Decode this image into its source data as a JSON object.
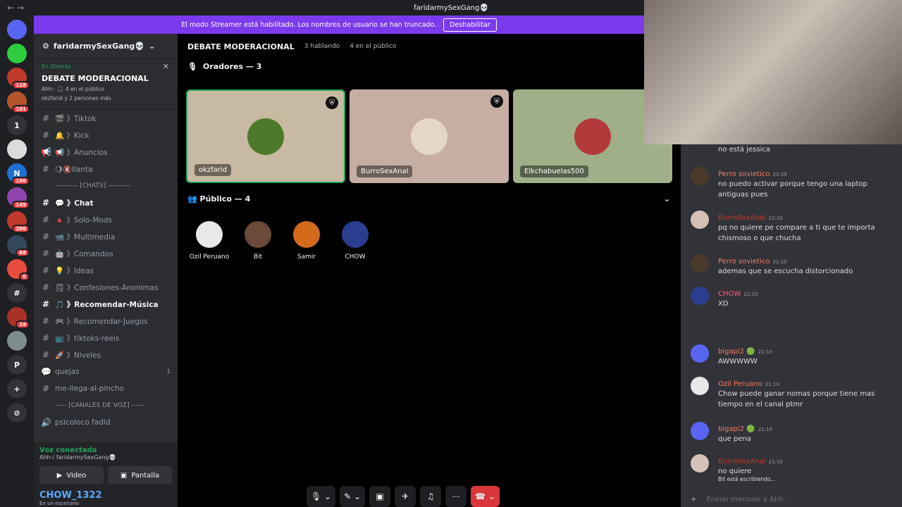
{
  "window": {
    "title": "faridarmySexGang💀",
    "nav": "← →"
  },
  "streamer_banner": {
    "text": "El modo Streamer está habilitado. Los nombres de usuario se han truncado.",
    "button": "Deshabilitar"
  },
  "rail": [
    {
      "label": "",
      "badge": ""
    },
    {
      "label": "",
      "badge": ""
    },
    {
      "label": "",
      "badge": "128"
    },
    {
      "label": "",
      "badge": "101"
    },
    {
      "label": "1",
      "badge": ""
    },
    {
      "label": "",
      "badge": ""
    },
    {
      "label": "N",
      "badge": "196"
    },
    {
      "label": "",
      "badge": "149"
    },
    {
      "label": "",
      "badge": "200"
    },
    {
      "label": "",
      "badge": "68"
    },
    {
      "label": "",
      "badge": "6"
    },
    {
      "label": "#",
      "badge": ""
    },
    {
      "label": "",
      "badge": "16"
    },
    {
      "label": "",
      "badge": ""
    },
    {
      "label": "P",
      "badge": ""
    },
    {
      "label": "+",
      "badge": ""
    },
    {
      "label": "⊘",
      "badge": ""
    }
  ],
  "sidebar": {
    "server_name": "faridarmySexGang💀",
    "live": {
      "status": "En Directo",
      "name": "DEBATE MODERACIONAL",
      "sub": "Ahh-· 🎧 4 en el público",
      "people": "okzfarid y 2 personas más"
    },
    "channels": [
      {
        "icon": "#",
        "name": "🎬 》Tiktok",
        "bold": false,
        "count": ""
      },
      {
        "icon": "#",
        "name": "🔔 》Kick",
        "bold": false,
        "count": ""
      },
      {
        "icon": "📢",
        "name": "📢 》Anuncios",
        "bold": false,
        "count": ""
      },
      {
        "icon": "#",
        "name": "🌖🔇llanta",
        "bold": false,
        "count": ""
      },
      {
        "icon": "",
        "name": "---------- [CHATS] ----------",
        "bold": false,
        "count": "",
        "cat": true
      },
      {
        "icon": "#",
        "name": "💬 》Chat",
        "bold": true,
        "count": ""
      },
      {
        "icon": "#",
        "name": "🔺 》Solo-Mods",
        "bold": false,
        "count": ""
      },
      {
        "icon": "#",
        "name": "📹 》Multimedia",
        "bold": false,
        "count": ""
      },
      {
        "icon": "#",
        "name": "🤖 》Comandos",
        "bold": false,
        "count": ""
      },
      {
        "icon": "#",
        "name": "💡 》Ideas",
        "bold": false,
        "count": ""
      },
      {
        "icon": "#",
        "name": "🗒 》Confesiones-Anonimas",
        "bold": false,
        "count": ""
      },
      {
        "icon": "#",
        "name": "🎵 》Recomendar-Música",
        "bold": true,
        "count": ""
      },
      {
        "icon": "#",
        "name": "🎮 》Recomendar-Juegos",
        "bold": false,
        "count": ""
      },
      {
        "icon": "#",
        "name": "📺 》tiktoks-reels",
        "bold": false,
        "count": ""
      },
      {
        "icon": "#",
        "name": "🚀 》Niveles",
        "bold": false,
        "count": ""
      },
      {
        "icon": "💬",
        "name": "quejas",
        "bold": false,
        "count": "1"
      },
      {
        "icon": "#",
        "name": "me-llega-al-pincho",
        "bold": false,
        "count": ""
      },
      {
        "icon": "",
        "name": "----- [CANALES DE VOZ] ------",
        "bold": false,
        "count": "",
        "cat": true
      },
      {
        "icon": "🔊",
        "name": "psicoloco fadid",
        "bold": false,
        "count": ""
      }
    ],
    "voice": {
      "status": "Voz conectada",
      "sub": "Ahh-/ faridarmySexGang💀",
      "video": "Video",
      "screen": "Pantalla",
      "user": "CHOW_1322",
      "user_status": "En un escenario"
    }
  },
  "main": {
    "header": {
      "title": "DEBATE MODERACIONAL",
      "speaking": "3 hablando",
      "audience": "4 en el público"
    },
    "speakers_label": "Oradores — 3",
    "speakers": [
      {
        "name": "okzfarid",
        "bg": "#c8b9a3",
        "av": "#4d7a2a",
        "shield": true,
        "active": true
      },
      {
        "name": "BurroSexAnal",
        "bg": "#c7aea3",
        "av": "#e4d7c7",
        "shield": true,
        "active": false
      },
      {
        "name": "Elkchabuelas500",
        "bg": "#9fb088",
        "av": "#b33a3a",
        "shield": false,
        "active": false
      }
    ],
    "audience_label": "Público — 4",
    "audience": [
      {
        "name": "Ozil Peruano",
        "av": "#e8e8e8"
      },
      {
        "name": "Bit",
        "av": "#6b4a3a"
      },
      {
        "name": "Samir",
        "av": "#d46b1c"
      },
      {
        "name": "CHOW",
        "av": "#2a3d8f"
      }
    ]
  },
  "chat": {
    "messages": [
      {
        "user": "",
        "color": "#dbdee1",
        "time": "",
        "text": "no está jessica",
        "av": "#a58f8a"
      },
      {
        "user": "Perro sovietico",
        "color": "#f47b67",
        "time": "21:09",
        "text": "no puedo activar porque tengo una laptop antiguas pues",
        "av": "#4a3a2a"
      },
      {
        "user": "BurroSexAnal",
        "color": "#c0392b",
        "time": "21:10",
        "text": "pq no quiere pe compare a ti que te importa chismoso o que chucha",
        "av": "#d6c1b8"
      },
      {
        "user": "Perro sovietico",
        "color": "#f47b67",
        "time": "21:10",
        "text": "ademas que se escucha distorcionado",
        "av": "#4a3a2a"
      },
      {
        "user": "CHOW",
        "color": "#ff5c8a",
        "time": "21:10",
        "text": "XD",
        "av": "#2a3d8f"
      },
      {
        "user": "bigapi2 🟢",
        "color": "#f47b67",
        "time": "21:10",
        "text": "AWWWWW",
        "av": "#5865f2"
      },
      {
        "user": "Ozil Peruano",
        "color": "#f47b67",
        "time": "21:10",
        "text": "Chow puede ganar nomas porque tiene mas tiempo en el canal ptmr",
        "av": "#e8e8e8"
      },
      {
        "user": "bigapi2 🟢",
        "color": "#f47b67",
        "time": "21:10",
        "text": "que pena",
        "av": "#5865f2"
      },
      {
        "user": "BurroSexAnal",
        "color": "#c0392b",
        "time": "21:10",
        "text": "no quiere",
        "av": "#d6c1b8"
      }
    ],
    "typing": "Bit está escribiendo...",
    "input_placeholder": "Enviar mensaje a Ahh-"
  }
}
